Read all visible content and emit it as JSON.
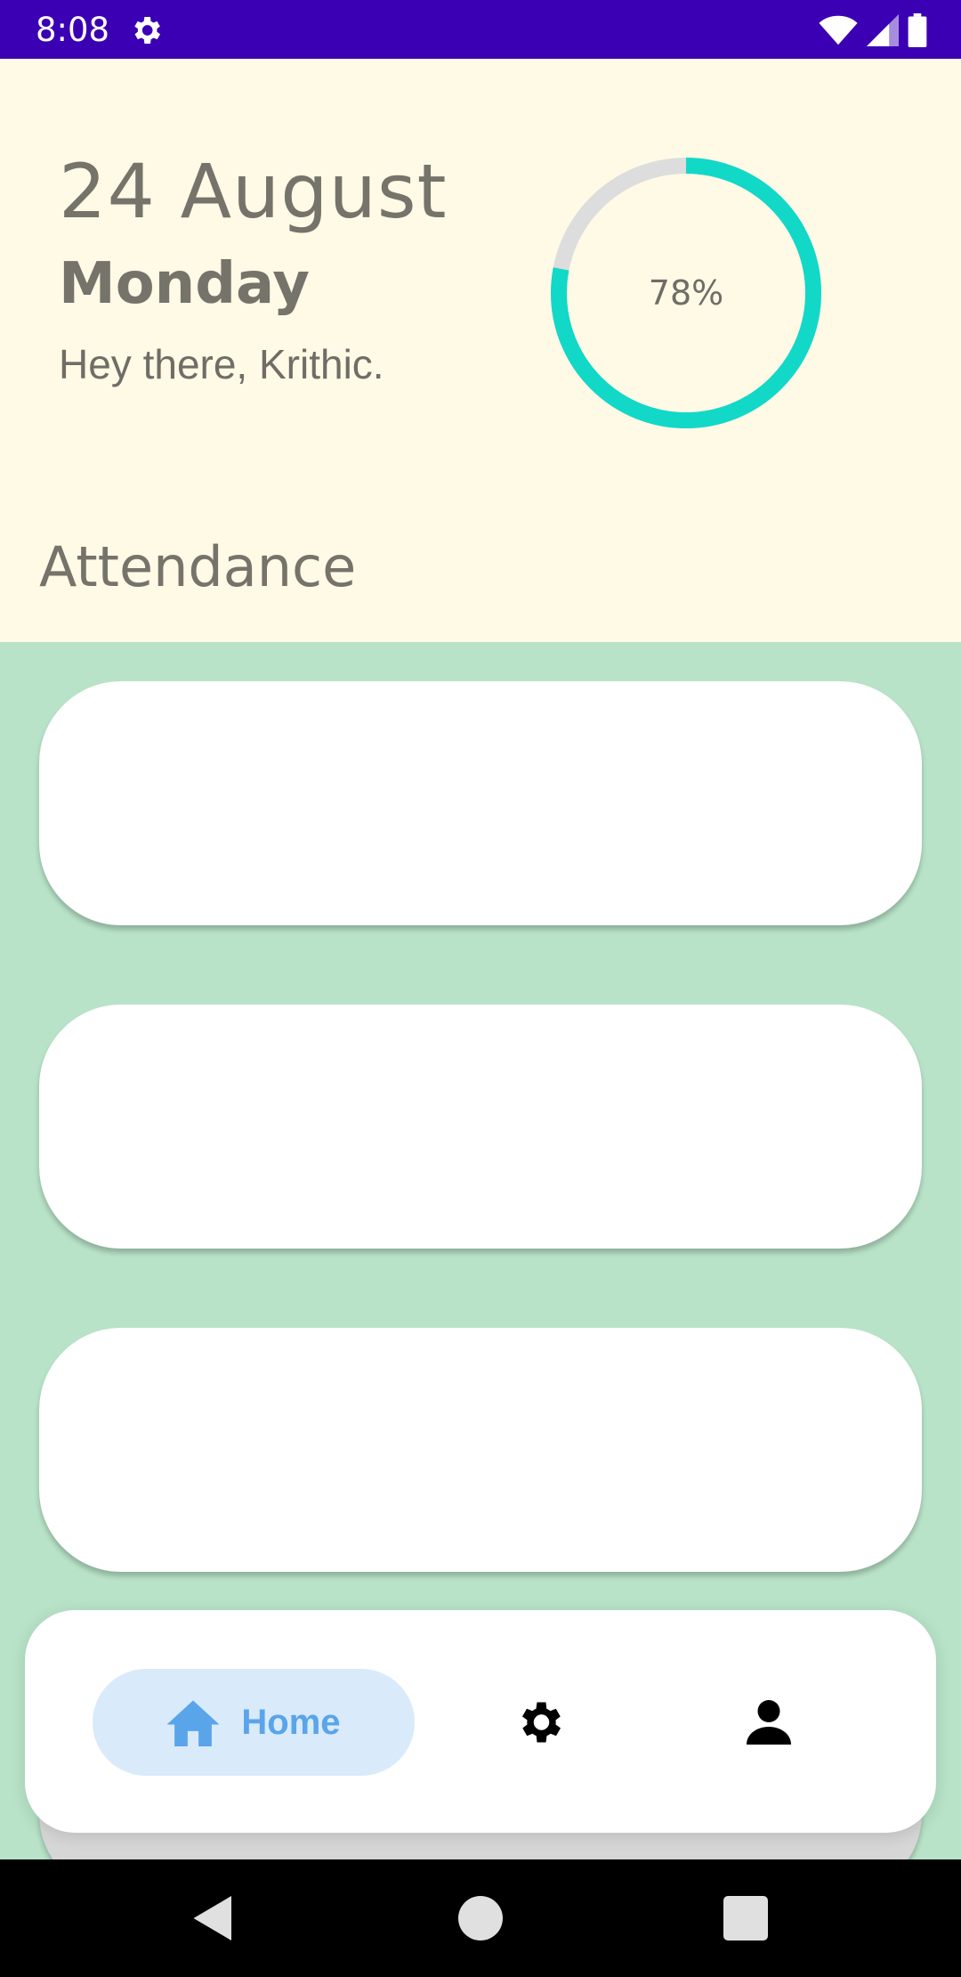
{
  "status_bar": {
    "time": "8:08",
    "background": "#3b00b4",
    "icons": [
      "gear-icon",
      "wifi-icon",
      "cell-signal-icon",
      "battery-icon"
    ]
  },
  "header": {
    "date": "24 August",
    "weekday": "Monday",
    "greeting": "Hey there, Krithic.",
    "progress": {
      "value": 0.78,
      "label": "78%",
      "color": "#12d8c8",
      "track_color": "#dddddd"
    },
    "background": "#fefae6"
  },
  "section": {
    "title": "Attendance"
  },
  "cards_background": "#b8e3c8",
  "bottom_nav": {
    "items": [
      {
        "label": "Home",
        "icon": "home-icon",
        "active": true,
        "color": "#5aa4ea"
      },
      {
        "icon": "gear-icon"
      },
      {
        "icon": "person-icon"
      }
    ]
  },
  "system_nav": {
    "icons": [
      "back-icon",
      "home-circle-icon",
      "recents-icon"
    ]
  }
}
